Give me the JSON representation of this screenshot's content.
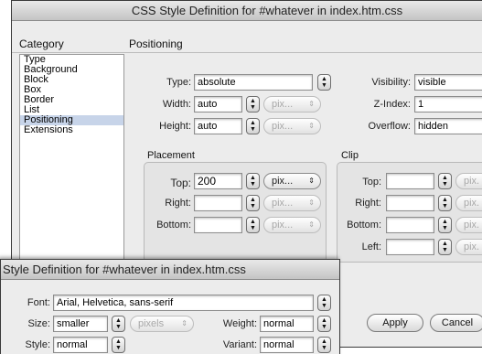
{
  "back_window": {
    "title": "CSS Style Definition for #whatever in index.htm.css",
    "category_header": "Category",
    "section_title": "Positioning",
    "categories": [
      "Type",
      "Background",
      "Block",
      "Box",
      "Border",
      "List",
      "Positioning",
      "Extensions"
    ],
    "selected_category": "Positioning",
    "type": {
      "label": "Type:",
      "value": "absolute"
    },
    "width": {
      "label": "Width:",
      "value": "auto",
      "unit": "pix..."
    },
    "height": {
      "label": "Height:",
      "value": "auto",
      "unit": "pix..."
    },
    "visibility": {
      "label": "Visibility:",
      "value": "visible"
    },
    "zindex": {
      "label": "Z-Index:",
      "value": "1"
    },
    "overflow": {
      "label": "Overflow:",
      "value": "hidden"
    },
    "placement": {
      "title": "Placement",
      "top": {
        "label": "Top:",
        "value": "200",
        "unit": "pix..."
      },
      "right": {
        "label": "Right:",
        "value": "",
        "unit": "pix..."
      },
      "bottom": {
        "label": "Bottom:",
        "value": "",
        "unit": "pix..."
      }
    },
    "clip": {
      "title": "Clip",
      "top": {
        "label": "Top:",
        "value": "",
        "unit": "pix."
      },
      "right": {
        "label": "Right:",
        "value": "",
        "unit": "pix."
      },
      "bottom": {
        "label": "Bottom:",
        "value": "",
        "unit": "pix."
      },
      "left": {
        "label": "Left:",
        "value": "",
        "unit": "pix."
      }
    },
    "apply_label": "Apply",
    "cancel_label": "Cancel"
  },
  "front_window": {
    "title": "Style Definition for #whatever in index.htm.css",
    "font": {
      "label": "Font:",
      "value": "Arial, Helvetica, sans-serif"
    },
    "size": {
      "label": "Size:",
      "value": "smaller",
      "unit": "pixels"
    },
    "weight": {
      "label": "Weight:",
      "value": "normal"
    },
    "style": {
      "label": "Style:",
      "value": "normal"
    },
    "variant": {
      "label": "Variant:",
      "value": "normal"
    }
  },
  "icons": {
    "stepper": "up-down-stepper-icon",
    "dropdown": "dropdown-arrow-icon"
  }
}
